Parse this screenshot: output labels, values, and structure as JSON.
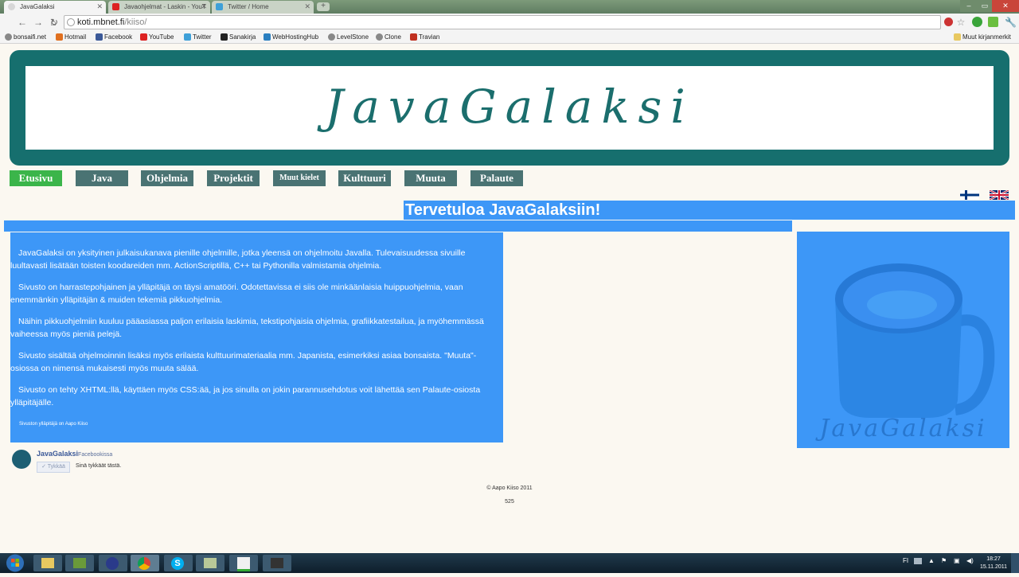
{
  "browser": {
    "tabs": [
      {
        "title": "JavaGalaksi",
        "active": true
      },
      {
        "title": "Javaohjelmat - Laskin - YouT",
        "active": false
      },
      {
        "title": "Twitter / Home",
        "active": false
      }
    ],
    "url_host": "koti.mbnet.fi",
    "url_path": "/kiiso/",
    "bookmarks": [
      "bonsaifi.net",
      "Hotmail",
      "Facebook",
      "YouTube",
      "Twitter",
      "Sanakirja",
      "WebHostingHub",
      "LevelStone",
      "Clone",
      "Travian"
    ],
    "other_bookmarks": "Muut kirjanmerkit"
  },
  "site": {
    "logo": "JavaGalaksi",
    "nav": [
      "Etusivu",
      "Java",
      "Ohjelmia",
      "Projektit",
      "Muut kielet",
      "Kulttuuri",
      "Muuta",
      "Palaute"
    ],
    "welcome": "Tervetuloa JavaGalaksiin!",
    "paragraphs": [
      "JavaGalaksi on yksityinen julkaisukanava pienille ohjelmille, jotka yleensä on ohjelmoitu Javalla. Tulevaisuudessa sivuille luultavasti lisätään toisten koodareiden mm. ActionScriptillä, C++ tai Pythonilla valmistamia ohjelmia.",
      "Sivusto on harrastepohjainen ja ylläpitäjä on täysi amatööri. Odotettavissa ei siis ole minkäänlaisia huippuohjelmia, vaan enemmänkin ylläpitäjän & muiden tekemiä pikkuohjelmia.",
      "Näihin pikkuohjelmiin kuuluu pääasiassa paljon erilaisia laskimia, tekstipohjaisia ohjelmia, grafiikkatestailua, ja myöhemmässä vaiheessa myös pieniä pelejä.",
      "Sivusto sisältää ohjelmoinnin lisäksi myös erilaista kulttuurimateriaalia mm. Japanista, esimerkiksi asiaa bonsaista. \"Muuta\"-osiossa on nimensä mukaisesti myös muuta sälää.",
      "Sivusto on tehty XHTML:llä, käyttäen myös CSS:ää, ja jos sinulla on jokin parannusehdotus voit lähettää sen Palaute-osiosta ylläpitäjälle."
    ],
    "maintainer_note": "Sivuston ylläpitäjä on Aapo Kiiso",
    "side_logo": "JavaGalaksi",
    "facebook": {
      "page_name": "JavaGalaksi",
      "suffix": "Facebookissa",
      "like_button": "Tykkää",
      "like_status": "Sinä tykkäät tästä."
    },
    "copyright": "© Aapo Kiiso 2011",
    "counter": "525"
  },
  "taskbar": {
    "language": "FI",
    "time": "18:27",
    "date": "15.11.2011"
  },
  "colors": {
    "banner": "#166f6e",
    "nav": "#4a7373",
    "nav_active": "#3bb54a",
    "content_blue": "#3d97f7"
  }
}
